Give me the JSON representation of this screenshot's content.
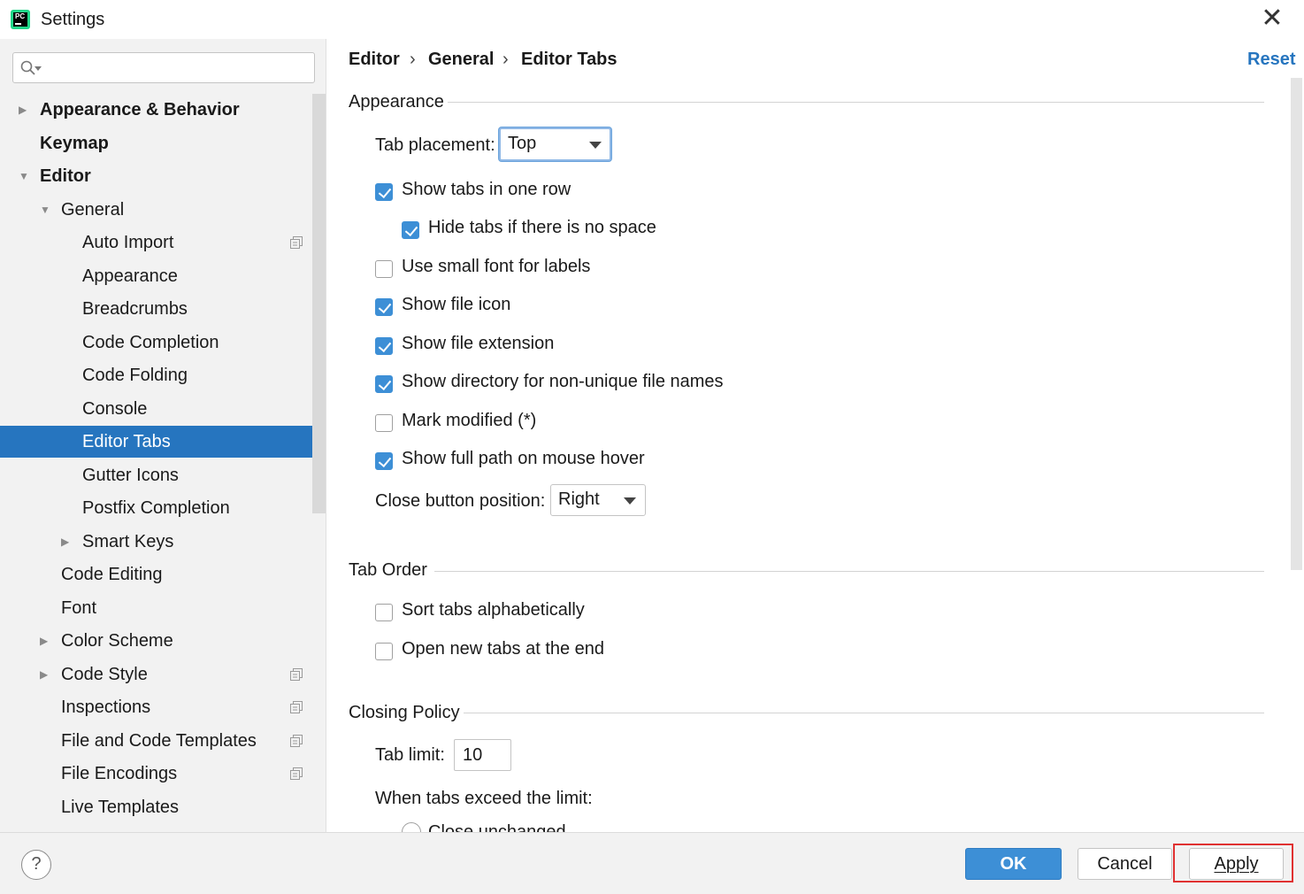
{
  "window": {
    "title": "Settings",
    "close_glyph": "✕",
    "logo_text": "PC"
  },
  "search": {
    "value": "",
    "placeholder": ""
  },
  "tree": [
    {
      "label": "Appearance & Behavior",
      "level": 0,
      "arrow": "▶",
      "bold": true
    },
    {
      "label": "Keymap",
      "level": 0,
      "arrow": "",
      "bold": true
    },
    {
      "label": "Editor",
      "level": 0,
      "arrow": "▼",
      "bold": true
    },
    {
      "label": "General",
      "level": 1,
      "arrow": "▼"
    },
    {
      "label": "Auto Import",
      "level": 2,
      "copy_icon": true
    },
    {
      "label": "Appearance",
      "level": 2
    },
    {
      "label": "Breadcrumbs",
      "level": 2
    },
    {
      "label": "Code Completion",
      "level": 2
    },
    {
      "label": "Code Folding",
      "level": 2
    },
    {
      "label": "Console",
      "level": 2
    },
    {
      "label": "Editor Tabs",
      "level": 2,
      "selected": true
    },
    {
      "label": "Gutter Icons",
      "level": 2
    },
    {
      "label": "Postfix Completion",
      "level": 2
    },
    {
      "label": "Smart Keys",
      "level": 2,
      "arrow": "▶"
    },
    {
      "label": "Code Editing",
      "level": 1
    },
    {
      "label": "Font",
      "level": 1
    },
    {
      "label": "Color Scheme",
      "level": 1,
      "arrow": "▶"
    },
    {
      "label": "Code Style",
      "level": 1,
      "arrow": "▶",
      "copy_icon": true
    },
    {
      "label": "Inspections",
      "level": 1,
      "copy_icon": true
    },
    {
      "label": "File and Code Templates",
      "level": 1,
      "copy_icon": true
    },
    {
      "label": "File Encodings",
      "level": 1,
      "copy_icon": true
    },
    {
      "label": "Live Templates",
      "level": 1
    }
  ],
  "breadcrumb": {
    "items": [
      "Editor",
      "General",
      "Editor Tabs"
    ],
    "separator": "›"
  },
  "reset_label": "Reset",
  "appearance": {
    "title": "Appearance",
    "tab_placement_label": "Tab placement:",
    "tab_placement_value": "Top",
    "options": [
      {
        "label": "Show tabs in one row",
        "checked": true
      },
      {
        "label": "Hide tabs if there is no space",
        "checked": true
      },
      {
        "label": "Use small font for labels",
        "checked": false
      },
      {
        "label": "Show file icon",
        "checked": true
      },
      {
        "label": "Show file extension",
        "checked": true
      },
      {
        "label": "Show directory for non-unique file names",
        "checked": true
      },
      {
        "label": "Mark modified (*)",
        "checked": false
      },
      {
        "label": "Show full path on mouse hover",
        "checked": true
      }
    ],
    "close_button_label": "Close button position:",
    "close_button_value": "Right"
  },
  "tab_order": {
    "title": "Tab Order",
    "options": [
      {
        "label": "Sort tabs alphabetically",
        "checked": false
      },
      {
        "label": "Open new tabs at the end",
        "checked": false
      }
    ]
  },
  "closing_policy": {
    "title": "Closing Policy",
    "tab_limit_label": "Tab limit:",
    "tab_limit_value": "10",
    "exceed_label": "When tabs exceed the limit:",
    "radio_label": "Close unchanged"
  },
  "footer": {
    "help": "?",
    "ok": "OK",
    "cancel": "Cancel",
    "apply": "Apply"
  },
  "colors": {
    "accent": "#2675bf",
    "checkbox": "#3d8fd6",
    "highlight": "#e03131"
  }
}
